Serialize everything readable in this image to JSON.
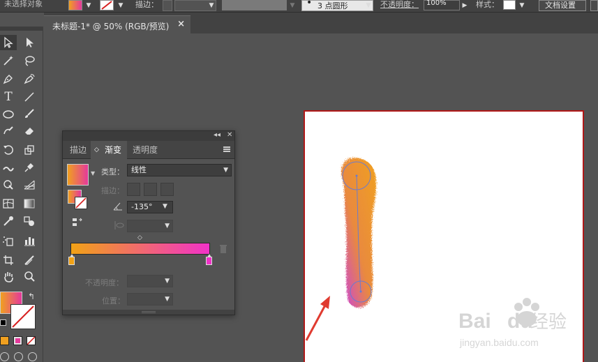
{
  "control_bar": {
    "selection_label": "未选择对象",
    "stroke_label": "描边：",
    "brush_label": "3 点圆形",
    "opacity_label": "不透明度：",
    "opacity_value": "100%",
    "style_label": "样式：",
    "doc_settings_button": "文档设置"
  },
  "document_tab": {
    "title": "未标题-1* @ 50% (RGB/预览)",
    "close_glyph": "×"
  },
  "gradient_panel": {
    "collapse_glyph": "◂◂",
    "close_glyph": "✕",
    "tabs": [
      {
        "label": "描边",
        "active": false
      },
      {
        "label": "渐变",
        "active": true
      },
      {
        "label": "透明度",
        "active": false
      }
    ],
    "active_tab_marker": "◇",
    "type_label": "类型：",
    "type_value": "线性",
    "stroke_label": "描边：",
    "angle_value": "-135°",
    "opacity_label": "不透明度：",
    "position_label": "位置：",
    "gradient": {
      "start_color": "#f1a216",
      "end_color": "#f132c8"
    }
  },
  "colors": {
    "artboard_border": "#b01818",
    "arrow": "#e03b30",
    "brush_orange": "#f0a020",
    "brush_magenta": "#d43cd8"
  },
  "watermark": {
    "line1": "Bai",
    "line1b": "du",
    "line1c": "经验",
    "line2": "jingyan.baidu.com"
  }
}
